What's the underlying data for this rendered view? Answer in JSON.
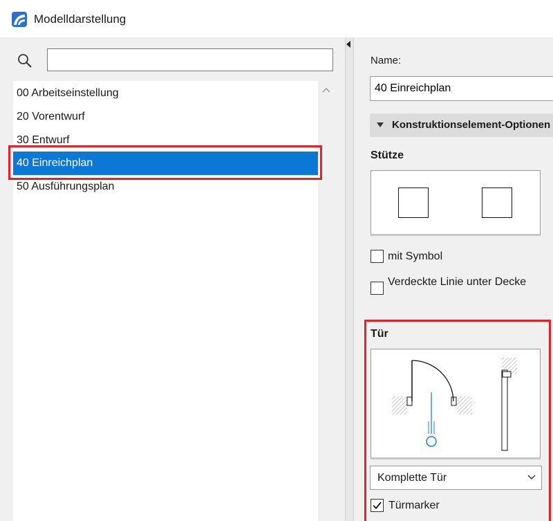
{
  "window": {
    "title": "Modelldarstellung",
    "app_icon": "archicad-icon"
  },
  "search": {
    "icon": "search-icon",
    "value": "",
    "placeholder": ""
  },
  "list": {
    "items": [
      {
        "label": "00 Arbeitseinstellung",
        "selected": false
      },
      {
        "label": "20 Vorentwurf",
        "selected": false
      },
      {
        "label": "30 Entwurf",
        "selected": false
      },
      {
        "label": "40 Einreichplan",
        "selected": true
      },
      {
        "label": "50 Ausführungsplan",
        "selected": false
      }
    ]
  },
  "details": {
    "name_label": "Name:",
    "name_value": "40 Einreichplan",
    "section_title": "Konstruktionselement-Optionen",
    "stuetze": {
      "title": "Stütze",
      "checkbox_symbol": {
        "label": "mit Symbol",
        "checked": false
      },
      "checkbox_verdeckte": {
        "label": "Verdeckte Linie unter Decke",
        "checked": false
      }
    },
    "tuer": {
      "title": "Tür",
      "option_selected": "Komplette Tür",
      "checkbox_marker": {
        "label": "Türmarker",
        "checked": true
      }
    }
  },
  "colors": {
    "selection": "#0a78d4",
    "highlight": "#e0222a",
    "marker_blue": "#1f7be0"
  }
}
